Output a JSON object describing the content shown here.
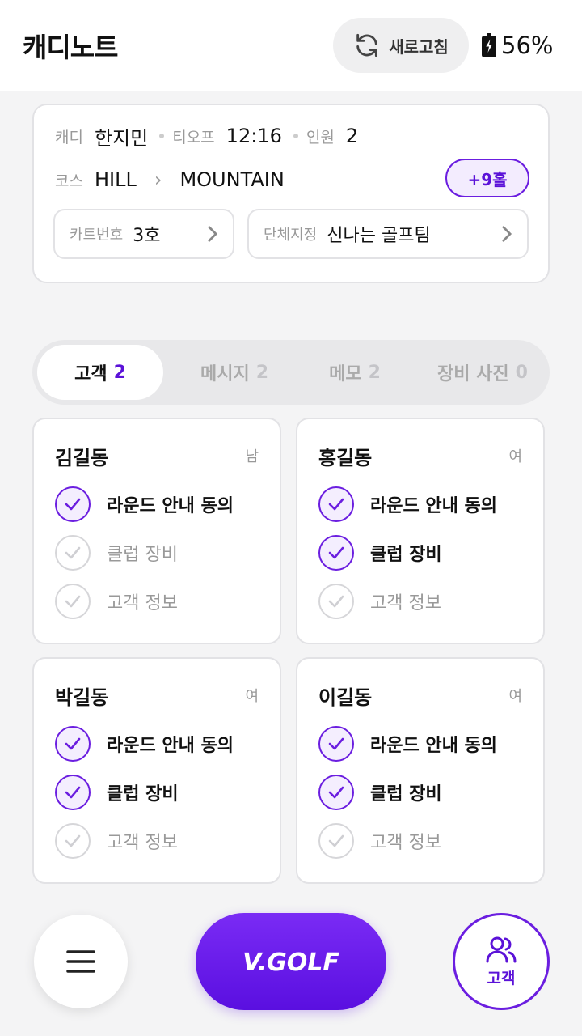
{
  "header": {
    "title": "캐디노트",
    "refresh_label": "새로고침",
    "battery": "56%"
  },
  "round_info": {
    "caddie_label": "캐디",
    "caddie_name": "한지민",
    "teeoff_label": "티오프",
    "teeoff_time": "12:16",
    "players_label": "인원",
    "players": "2",
    "course_label": "코스",
    "course_from": "HILL",
    "course_to": "MOUNTAIN",
    "extra_holes": "+9홀",
    "cart_label": "카트번호",
    "cart_value": "3호",
    "group_label": "단체지정",
    "group_value": "신나는 골프팀"
  },
  "tabs": [
    {
      "label": "고객",
      "count": "2",
      "active": true
    },
    {
      "label": "메시지",
      "count": "2",
      "active": false
    },
    {
      "label": "메모",
      "count": "2",
      "active": false
    },
    {
      "label": "장비 사진",
      "count": "0",
      "active": false
    }
  ],
  "customers": [
    {
      "name": "김길동",
      "gender": "남",
      "checks": [
        {
          "label": "라운드 안내 동의",
          "done": true
        },
        {
          "label": "클럽 장비",
          "done": false
        },
        {
          "label": "고객 정보",
          "done": false
        }
      ]
    },
    {
      "name": "홍길동",
      "gender": "여",
      "checks": [
        {
          "label": "라운드 안내 동의",
          "done": true
        },
        {
          "label": "클럽 장비",
          "done": true
        },
        {
          "label": "고객 정보",
          "done": false
        }
      ]
    },
    {
      "name": "박길동",
      "gender": "여",
      "checks": [
        {
          "label": "라운드 안내 동의",
          "done": true
        },
        {
          "label": "클럽 장비",
          "done": true
        },
        {
          "label": "고객 정보",
          "done": false
        }
      ]
    },
    {
      "name": "이길동",
      "gender": "여",
      "checks": [
        {
          "label": "라운드 안내 동의",
          "done": true
        },
        {
          "label": "클럽 장비",
          "done": true
        },
        {
          "label": "고객 정보",
          "done": false
        }
      ]
    }
  ],
  "bottom": {
    "brand": "V.GOLF",
    "customer_label": "고객"
  },
  "colors": {
    "accent": "#6b1ee0",
    "accent_dark": "#5b12d8"
  },
  "icons": [
    "refresh-icon",
    "battery-icon",
    "chevron-right-icon",
    "check-icon",
    "menu-icon",
    "users-icon"
  ]
}
